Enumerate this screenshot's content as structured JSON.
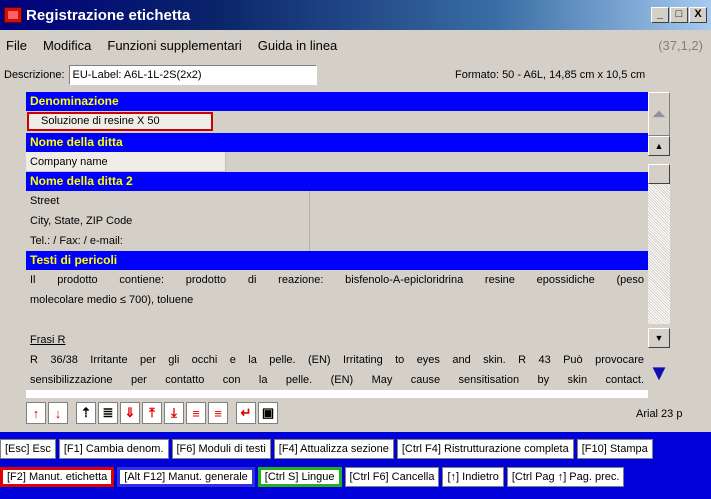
{
  "window": {
    "title": "Registrazione etichetta",
    "controls": [
      "_",
      "□",
      "X"
    ]
  },
  "menu": {
    "items": [
      "File",
      "Modifica",
      "Funzioni supplementari",
      "Guida in linea"
    ],
    "coords": "(37,1,2)"
  },
  "description": {
    "label": "Descrizione:",
    "value": "EU-Label: A6L-1L-2S(2x2)",
    "format": "Formato: 50 - A6L, 14,85 cm x 10,5 cm"
  },
  "sections": {
    "denominazione": "Denominazione",
    "denominazione_value": "Soluzione di resine X 50",
    "nome_ditta": "Nome della ditta",
    "nome_ditta_value": "Company name",
    "nome_ditta2": "Nome della ditta 2",
    "street": "Street",
    "city": "City, State, ZIP Code",
    "tel": "Tel.:  /  Fax:  /  e-mail:",
    "testi_pericoli": "Testi di pericoli",
    "hazard_line1": "Il prodotto contiene: prodotto di reazione: bisfenolo-A-epicloridrina resine epossidiche (peso",
    "hazard_line2": "molecolare medio ≤ 700), toluene",
    "frasi_r": "Frasi R",
    "r_line1": "R 36/38 Irritante per gli occhi e la pelle. (EN) Irritating to eyes and skin. R 43 Può provocare",
    "r_line2": "sensibilizzazione per contatto con la pelle. (EN) May cause sensitisation by skin contact."
  },
  "font_info": "Arial 23 p",
  "fkeys_row1": [
    "[Esc] Esc",
    "[F1] Cambia denom.",
    "[F6] Moduli di testi",
    "[F4] Attualizza sezione",
    "[Ctrl F4] Ristrutturazione completa",
    "[F10] Stampa"
  ],
  "fkeys_row2": [
    "[F2] Manut. etichetta",
    "[Alt F12] Manut. generale",
    "[Ctrl S] Lingue",
    "[Ctrl F6] Cancella",
    "[↑] Indietro",
    "[Ctrl Pag ↑] Pag. prec."
  ],
  "colors": {
    "background": "#0000d8",
    "section_header": "#0000ff",
    "section_text": "#ffff00",
    "red_highlight": "#e00000",
    "blue_highlight": "#3030e0",
    "green_highlight": "#20b020"
  }
}
